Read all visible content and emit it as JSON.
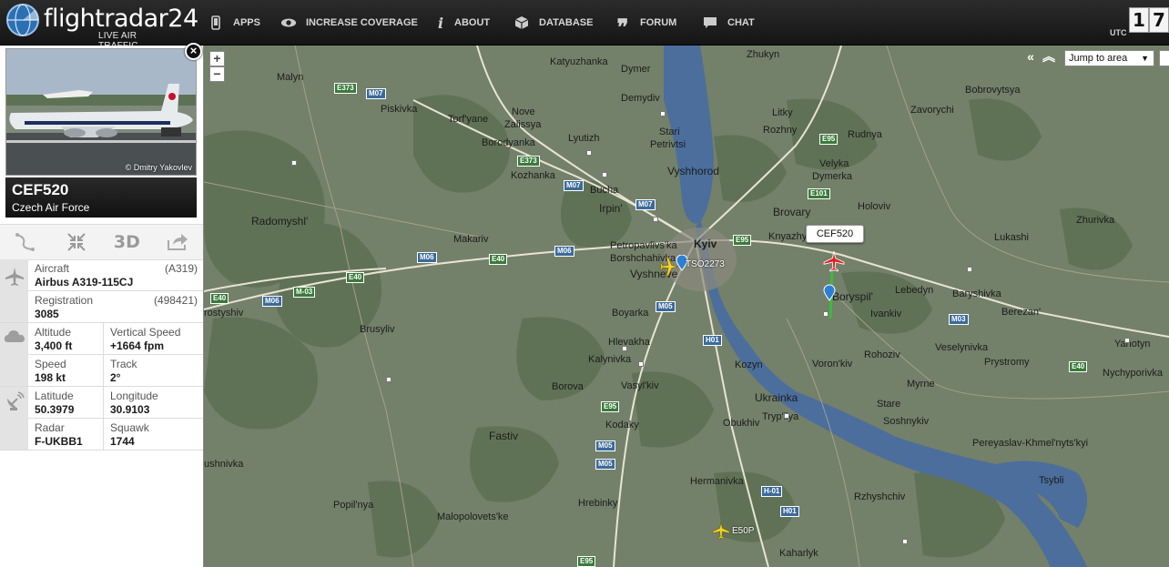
{
  "app": {
    "brand": "flightradar24",
    "tagline": "LIVE AIR TRAFFIC"
  },
  "nav": {
    "items": [
      {
        "label": "APPS",
        "icon": "phone-icon"
      },
      {
        "label": "INCREASE COVERAGE",
        "icon": "eye-icon"
      },
      {
        "label": "ABOUT",
        "icon": "info-icon"
      },
      {
        "label": "DATABASE",
        "icon": "database-icon"
      },
      {
        "label": "FORUM",
        "icon": "quote-icon"
      },
      {
        "label": "CHAT",
        "icon": "chat-bubble-icon"
      }
    ],
    "utc_label": "UTC",
    "clock_digits": [
      "1",
      "7"
    ]
  },
  "flight": {
    "photo_credit": "© Dmitry Yakovlev",
    "callsign": "CEF520",
    "airline": "Czech Air Force",
    "actions": {
      "three_d": "3D"
    },
    "aircraft": {
      "label": "Aircraft",
      "code": "(A319)",
      "value": "Airbus A319-115CJ"
    },
    "registration": {
      "label": "Registration",
      "code": "(498421)",
      "value": "3085"
    },
    "altitude": {
      "label": "Altitude",
      "value": "3,400 ft"
    },
    "vertical_speed": {
      "label": "Vertical Speed",
      "value": "+1664 fpm"
    },
    "speed": {
      "label": "Speed",
      "value": "198 kt"
    },
    "track": {
      "label": "Track",
      "value": "2°"
    },
    "latitude": {
      "label": "Latitude",
      "value": "50.3979"
    },
    "longitude": {
      "label": "Longitude",
      "value": "30.9103"
    },
    "radar": {
      "label": "Radar",
      "value": "F-UKBB1"
    },
    "squawk": {
      "label": "Squawk",
      "value": "1744"
    }
  },
  "map": {
    "zoom_in": "+",
    "zoom_out": "−",
    "jump_to_area": "Jump to area",
    "selected_tag": "CEF520",
    "flight_labels": [
      "TSO2273",
      "E50P"
    ],
    "cities": [
      "Malyn",
      "Katyuzhanka",
      "Dymer",
      "Zhukyn",
      "Bobrovytsya",
      "Zavorychi",
      "Piskivka",
      "Demydiv",
      "Litky",
      "Rozhny",
      "Torf'yane",
      "Nove",
      "Zalissya",
      "Lyutizh",
      "Stari",
      "Petrivtsi",
      "Rudnya",
      "Borodyanka",
      "Velyka",
      "Dymerka",
      "Kozhanka",
      "Vyshhorod",
      "Bucha",
      "Holoviv",
      "Zhurivka",
      "Radomyshl'",
      "Irpin'",
      "Brovary",
      "Knyazhychi",
      "Lukashi",
      "Makariv",
      "Petropavlivs'ka",
      "Borshchahivka",
      "Kyiv",
      "Vyshneve",
      "Boryspil'",
      "Lebedyn",
      "Baryshivka",
      "rostyshiv",
      "Boyarka",
      "Ivankiv",
      "Berezan'",
      "Brusyliv",
      "Hlevakha",
      "Kalynivka",
      "Rohoziv",
      "Veselynivka",
      "Yahotyn",
      "Kozyn",
      "Voron'kiv",
      "Prystromy",
      "Nychyporivka",
      "Borova",
      "Vasyl'kiv",
      "Myrne",
      "Ukrainka",
      "Stare",
      "Tryp'llya",
      "Soshnykiv",
      "Kodaky",
      "Obukhiv",
      "Fastiv",
      "Pereyaslav-Khmel'nyts'kyi",
      "ushnivka",
      "Tsybli",
      "Hermanivka",
      "Rzhyshchiv",
      "Popil'nya",
      "Hrebinky",
      "Malopolovets'ke",
      "Kaharlyk"
    ],
    "roads": [
      "E373",
      "M07",
      "E373",
      "M07",
      "E95",
      "E101",
      "M07",
      "M06",
      "E40",
      "E95",
      "M06",
      "E40",
      "M-03",
      "E40",
      "M06",
      "M05",
      "H01",
      "M03",
      "E40",
      "E95",
      "M05",
      "M05",
      "H-01",
      "H01",
      "E95"
    ]
  }
}
